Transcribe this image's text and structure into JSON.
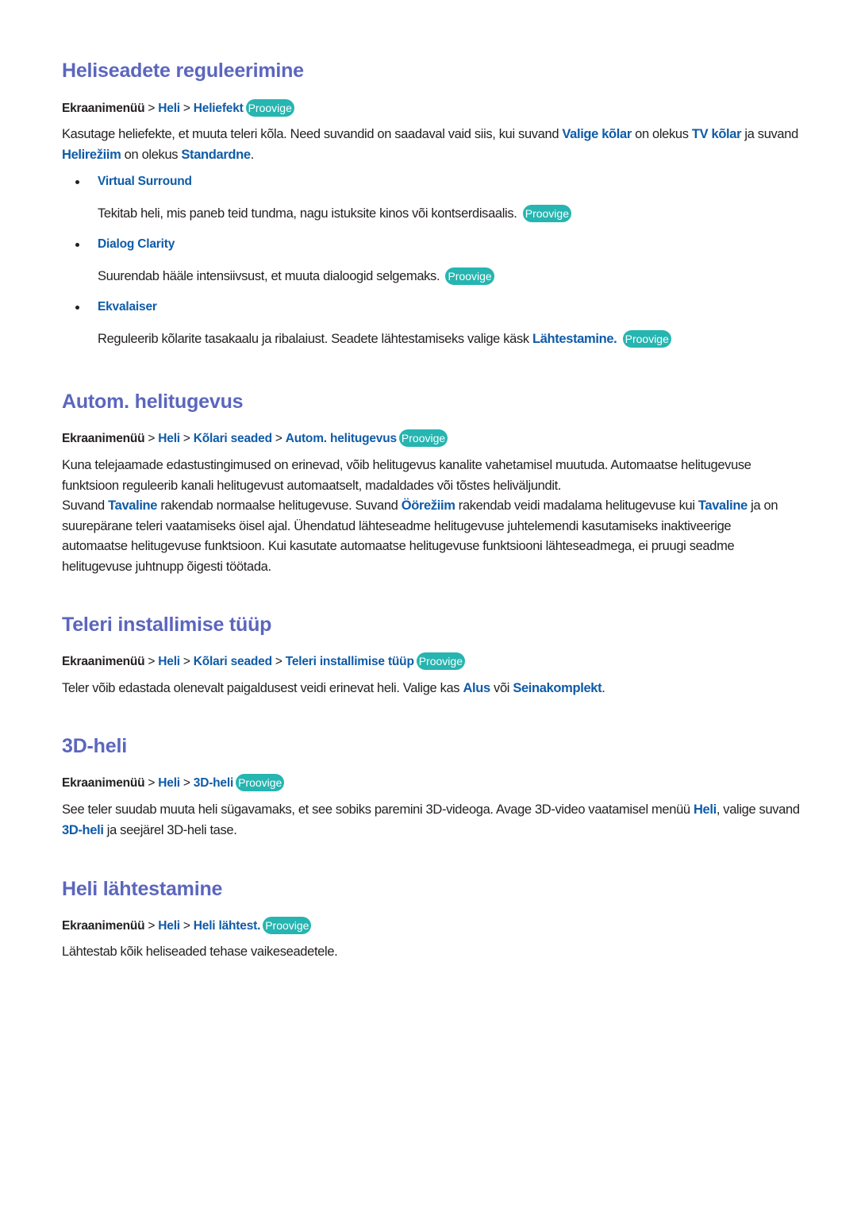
{
  "colors": {
    "heading": "#5b66be",
    "link": "#0f5ba8",
    "badge": "#26b5b0",
    "text": "#231f20"
  },
  "badge_label": "Proovige",
  "sections": [
    {
      "id": "heliseadete",
      "title": "Heliseadete reguleerimine",
      "path": [
        "Ekraanimenüü",
        "Heli",
        "Heliefekt"
      ],
      "path_badge": true,
      "body": [
        [
          {
            "t": "Kasutage heliefekte, et muuta teleri kõla. Need suvandid on saadaval vaid siis, kui suvand "
          },
          {
            "t": "Valige kõlar",
            "link": true
          },
          {
            "t": " on olekus "
          },
          {
            "t": "TV kõlar",
            "link": true
          },
          {
            "t": " ja suvand "
          },
          {
            "t": "Helirežiim",
            "link": true
          },
          {
            "t": " on olekus "
          },
          {
            "t": "Standardne",
            "link": true
          },
          {
            "t": "."
          }
        ]
      ],
      "bullets": [
        {
          "title": "Virtual Surround",
          "desc": [
            {
              "t": "Tekitab heli, mis paneb teid tundma, nagu istuksite kinos või kontserdisaalis. "
            }
          ],
          "badge": true
        },
        {
          "title": "Dialog Clarity",
          "desc": [
            {
              "t": "Suurendab hääle intensiivsust, et muuta dialoogid selgemaks. "
            }
          ],
          "badge": true
        },
        {
          "title": "Ekvalaiser",
          "desc": [
            {
              "t": "Reguleerib kõlarite tasakaalu ja ribalaiust. Seadete lähtestamiseks valige käsk "
            },
            {
              "t": "Lähtestamine.",
              "link": true
            },
            {
              "t": " "
            }
          ],
          "badge": true
        }
      ]
    },
    {
      "id": "autom-helitugevus",
      "title": "Autom. helitugevus",
      "path": [
        "Ekraanimenüü",
        "Heli",
        "Kõlari seaded",
        "Autom. helitugevus"
      ],
      "path_badge": true,
      "body": [
        [
          {
            "t": "Kuna telejaamade edastustingimused on erinevad, võib helitugevus kanalite vahetamisel muutuda. Automaatse helitugevuse funktsioon reguleerib kanali helitugevust automaatselt, madaldades või tõstes heliväljundit."
          }
        ],
        [
          {
            "t": "Suvand "
          },
          {
            "t": "Tavaline",
            "link": true
          },
          {
            "t": " rakendab normaalse helitugevuse. Suvand "
          },
          {
            "t": "Öörežiim",
            "link": true
          },
          {
            "t": " rakendab veidi madalama helitugevuse kui "
          },
          {
            "t": "Tavaline",
            "link": true
          },
          {
            "t": " ja on suurepärane teleri vaatamiseks öisel ajal. Ühendatud lähteseadme helitugevuse juhtelemendi kasutamiseks inaktiveerige automaatse helitugevuse funktsioon. Kui kasutate automaatse helitugevuse funktsiooni lähteseadmega, ei pruugi seadme helitugevuse juhtnupp õigesti töötada."
          }
        ]
      ]
    },
    {
      "id": "teleri-installimise-tyyp",
      "title": "Teleri installimise tüüp",
      "path": [
        "Ekraanimenüü",
        "Heli",
        "Kõlari seaded",
        "Teleri installimise tüüp"
      ],
      "path_badge": true,
      "body": [
        [
          {
            "t": "Teler võib edastada olenevalt paigaldusest veidi erinevat heli. Valige kas "
          },
          {
            "t": "Alus",
            "link": true
          },
          {
            "t": " või "
          },
          {
            "t": "Seinakomplekt",
            "link": true
          },
          {
            "t": "."
          }
        ]
      ]
    },
    {
      "id": "3d-heli",
      "title": "3D-heli",
      "path": [
        "Ekraanimenüü",
        "Heli",
        "3D-heli"
      ],
      "path_badge": true,
      "body": [
        [
          {
            "t": "See teler suudab muuta heli sügavamaks, et see sobiks paremini 3D-videoga. Avage 3D-video vaatamisel menüü "
          },
          {
            "t": "Heli",
            "link": true
          },
          {
            "t": ", valige suvand "
          },
          {
            "t": "3D-heli",
            "link": true
          },
          {
            "t": " ja seejärel 3D-heli tase."
          }
        ]
      ]
    },
    {
      "id": "heli-lahtestamine",
      "title": "Heli lähtestamine",
      "path": [
        "Ekraanimenüü",
        "Heli",
        "Heli lähtest."
      ],
      "path_badge": true,
      "body": [
        [
          {
            "t": "Lähtestab kõik heliseaded tehase vaikeseadetele."
          }
        ]
      ]
    }
  ]
}
